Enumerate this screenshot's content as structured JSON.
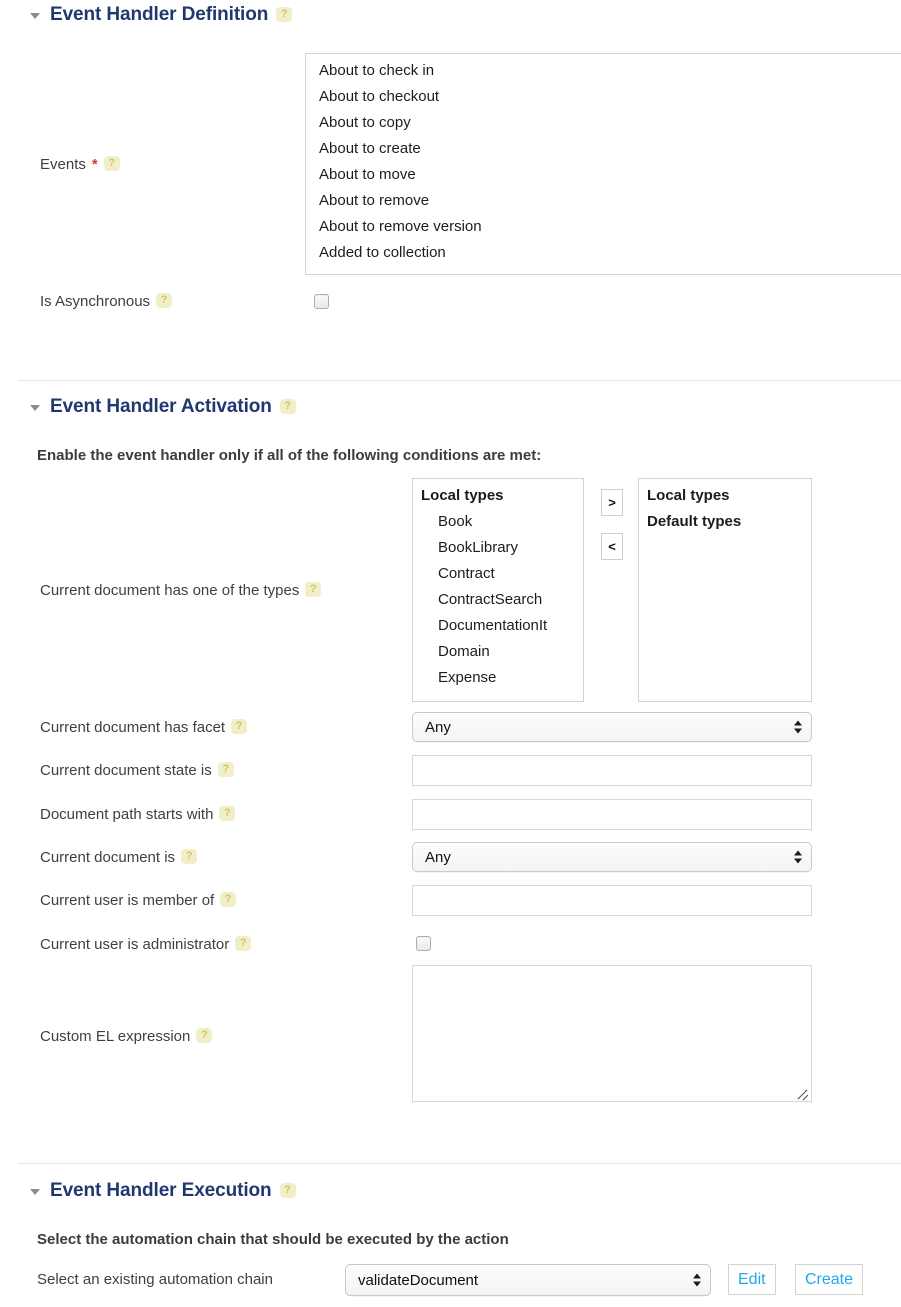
{
  "theme": {
    "heading_color": "#21386e",
    "help_badge_bg": "#f2efc8",
    "help_badge_fg": "#cfc46a",
    "required_color": "#e03131",
    "link_button_color": "#20a8ea",
    "divider_color": "#e6e7ee"
  },
  "help_glyph": "?",
  "sections": {
    "definition": {
      "title": "Event Handler Definition",
      "help": "?",
      "events": {
        "label": "Events",
        "required_marker": "*",
        "help": "?",
        "options": [
          "About to check in",
          "About to checkout",
          "About to copy",
          "About to create",
          "About to move",
          "About to remove",
          "About to remove version",
          "Added to collection"
        ]
      },
      "is_async": {
        "label": "Is Asynchronous",
        "help": "?",
        "checked": false
      }
    },
    "activation": {
      "title": "Event Handler Activation",
      "help": "?",
      "note": "Enable the event handler only if all of the following conditions are met:",
      "types": {
        "label": "Current document has one of the types",
        "help": "?",
        "available": {
          "group": "Local types",
          "items": [
            "Book",
            "BookLibrary",
            "Contract",
            "ContractSearch",
            "DocumentationIt",
            "Domain",
            "Expense"
          ]
        },
        "selected_groups": [
          "Local types",
          "Default types"
        ],
        "add_button": ">",
        "remove_button": "<"
      },
      "facet": {
        "label": "Current document has facet",
        "help": "?",
        "value": "Any"
      },
      "state": {
        "label": "Current document state is",
        "help": "?",
        "value": "",
        "placeholder": ""
      },
      "path": {
        "label": "Document path starts with",
        "help": "?",
        "value": "",
        "placeholder": ""
      },
      "doc_is": {
        "label": "Current document is",
        "help": "?",
        "value": "Any"
      },
      "member_of": {
        "label": "Current user is member of",
        "help": "?",
        "value": "",
        "placeholder": ""
      },
      "is_admin": {
        "label": "Current user is administrator",
        "help": "?",
        "checked": false
      },
      "el_expression": {
        "label": "Custom EL expression",
        "help": "?",
        "value": "",
        "placeholder": ""
      }
    },
    "execution": {
      "title": "Event Handler Execution",
      "help": "?",
      "note": "Select the automation chain that should be executed by the action",
      "chain": {
        "label": "Select an existing automation chain",
        "value": "validateDocument",
        "edit_label": "Edit",
        "create_label": "Create"
      }
    }
  }
}
